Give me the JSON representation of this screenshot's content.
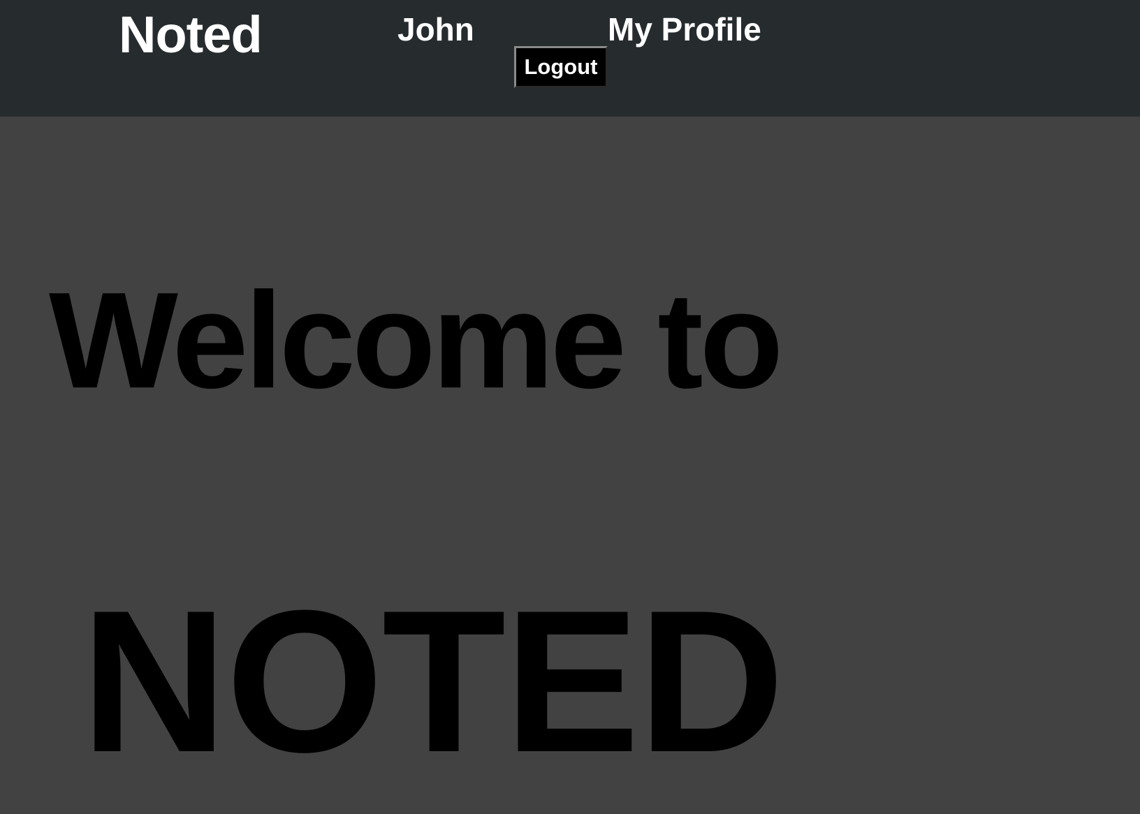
{
  "navbar": {
    "brand": "Noted",
    "user_name": "John",
    "profile_link": "My Profile",
    "logout_label": "Logout"
  },
  "hero": {
    "welcome": "Welcome to",
    "title": "NOTED"
  },
  "colors": {
    "navbar_bg": "#262b2e",
    "page_bg": "#424242",
    "nav_text": "#ffffff",
    "hero_text": "#000000",
    "button_bg": "#000000"
  }
}
